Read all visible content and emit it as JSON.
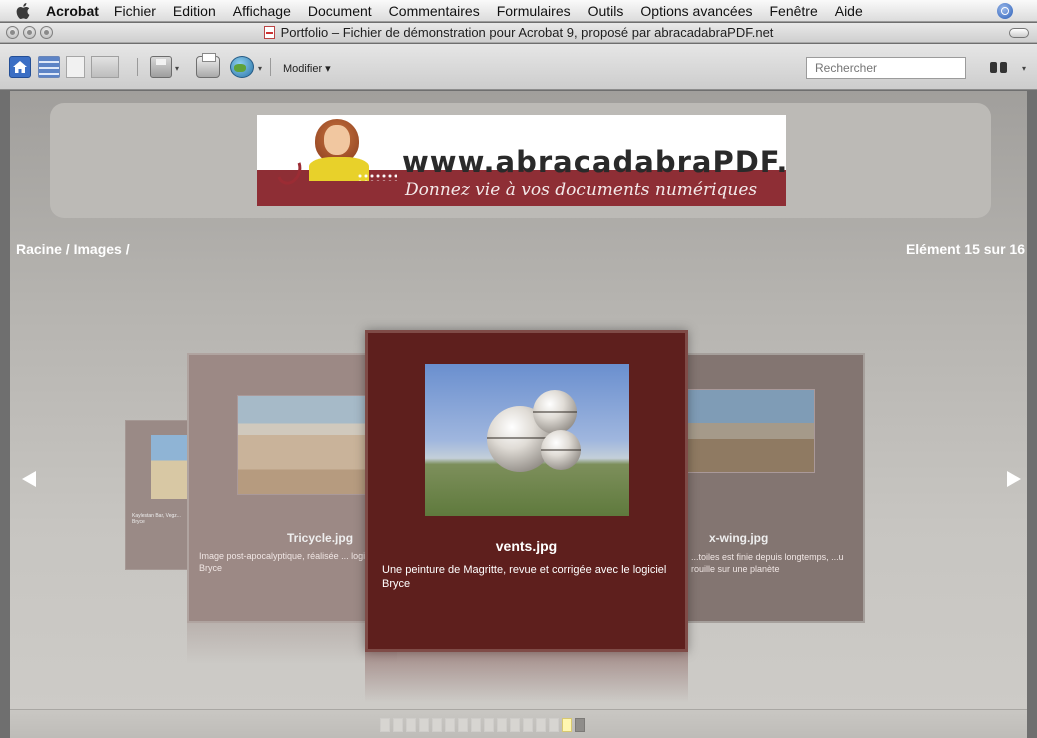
{
  "menubar": {
    "app": "Acrobat",
    "items": [
      "Fichier",
      "Edition",
      "Affichage",
      "Document",
      "Commentaires",
      "Formulaires",
      "Outils",
      "Options avancées",
      "Fenêtre",
      "Aide"
    ]
  },
  "window": {
    "title": "Portfolio – Fichier de démonstration pour Acrobat 9, proposé par abracadabraPDF.net"
  },
  "toolbar": {
    "modify_label": "Modifier ▾",
    "search_placeholder": "Rechercher",
    "dropdown_arrow": "▾"
  },
  "banner": {
    "url": "www.abracadabraPDF.net",
    "tagline": "Donnez vie à vos documents numériques"
  },
  "navigation": {
    "breadcrumb": "Racine / Images /",
    "counter": "Elément 15 sur 16"
  },
  "cards": {
    "far_left": {
      "desc": "Kaylestan Bar, Vegz... Bryce"
    },
    "left": {
      "name": "Tricycle.jpg",
      "desc": "Image post-apocalyptique, réalisée ... logiciel Bryce"
    },
    "center": {
      "name": "vents.jpg",
      "desc": "Une peinture de Magritte, revue et corrigée avec le logiciel Bryce"
    },
    "right": {
      "name": "x-wing.jpg",
      "desc": "...toiles est finie depuis longtemps, ...u rouille sur une planète"
    }
  },
  "page_strip": {
    "count": 16,
    "current": 15
  },
  "colors": {
    "card_selected": "#5e1f1d",
    "banner_band": "#8e2e35",
    "content_bg": "#b6b4b0"
  },
  "icons": [
    "apple-icon",
    "spotlight-icon",
    "home-icon",
    "binoculars-icon",
    "printer-icon",
    "save-icon",
    "share-icon"
  ]
}
